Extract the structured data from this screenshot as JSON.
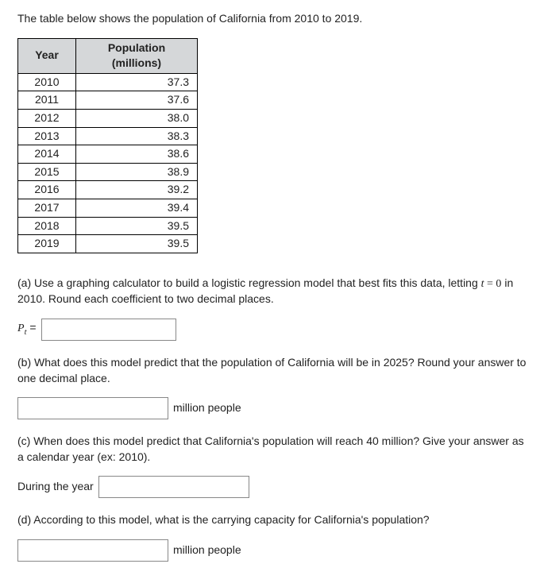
{
  "intro": "The table below shows the population of California from 2010 to 2019.",
  "table": {
    "headers": {
      "year": "Year",
      "pop": "Population (millions)"
    },
    "rows": [
      {
        "year": "2010",
        "pop": "37.3"
      },
      {
        "year": "2011",
        "pop": "37.6"
      },
      {
        "year": "2012",
        "pop": "38.0"
      },
      {
        "year": "2013",
        "pop": "38.3"
      },
      {
        "year": "2014",
        "pop": "38.6"
      },
      {
        "year": "2015",
        "pop": "38.9"
      },
      {
        "year": "2016",
        "pop": "39.2"
      },
      {
        "year": "2017",
        "pop": "39.4"
      },
      {
        "year": "2018",
        "pop": "39.5"
      },
      {
        "year": "2019",
        "pop": "39.5"
      }
    ]
  },
  "parts": {
    "a": {
      "prefix": "(a) Use a graphing calculator to build a logistic regression model that best fits this data, letting ",
      "tvar": "t",
      "eq": " = 0",
      "suffix": " in 2010. Round each coefficient to two decimal places.",
      "lhs_var": "P",
      "lhs_sub": "t",
      "equals": " ="
    },
    "b": {
      "text": "(b) What does this model predict that the population of California will be in 2025? Round your answer to one decimal place.",
      "unit": "million people"
    },
    "c": {
      "text": "(c) When does this model predict that California's population will reach 40 million? Give your answer as a calendar year (ex: 2010).",
      "label": "During the year"
    },
    "d": {
      "text": "(d) According to this model, what is the carrying capacity for California's population?",
      "unit": "million people"
    }
  }
}
